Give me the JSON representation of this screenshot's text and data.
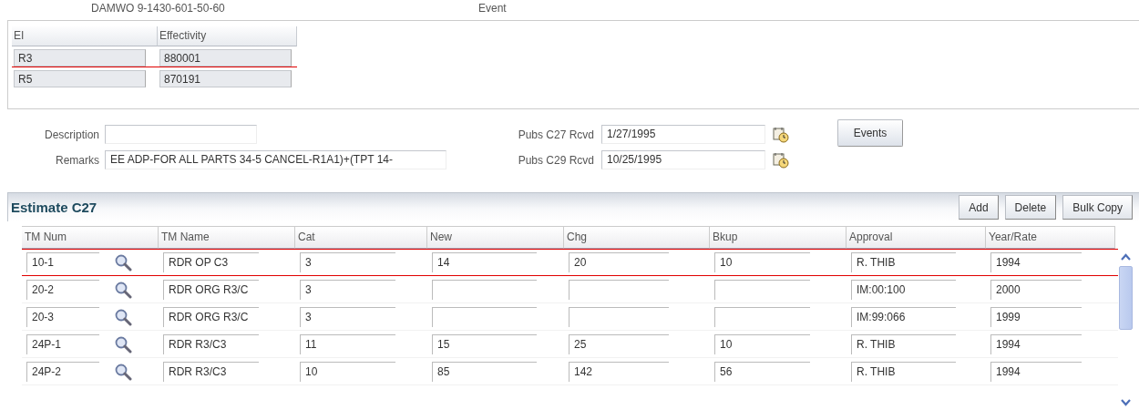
{
  "header": {
    "work_order": "DAMWO  9-1430-601-50-60",
    "event_label": "Event"
  },
  "effectivity_table": {
    "columns": [
      "EI",
      "Effectivity"
    ],
    "rows": [
      {
        "cells": [
          "R3",
          "880001"
        ],
        "selected": true
      },
      {
        "cells": [
          "R5",
          "870191"
        ],
        "selected": false
      }
    ]
  },
  "form": {
    "description": {
      "label": "Description"
    },
    "remarks": {
      "label": "Remarks",
      "value": "EE ADP-FOR ALL PARTS  34-5 CANCEL-R1A1)+(TPT 14-"
    },
    "pubs": [
      {
        "label": "Pubs C27 Rcvd",
        "value": "1/27/1995"
      },
      {
        "label": "Pubs C29 Rcvd",
        "value": "10/25/1995"
      }
    ],
    "events_button": "Events"
  },
  "estimate": {
    "title": "Estimate C27",
    "buttons": [
      "Add",
      "Delete",
      "Bulk Copy"
    ],
    "columns": [
      "TM Num",
      "TM Name",
      "Cat",
      "New",
      "Chg",
      "Bkup",
      "Approval",
      "Year/Rate"
    ],
    "rows": [
      {
        "selected": true,
        "cells": [
          "10-1",
          "RDR OP C3",
          "3",
          "14",
          "20",
          "10",
          "R. THIB",
          "1994"
        ]
      },
      {
        "selected": false,
        "cells": [
          "20-2",
          "RDR ORG R3/C",
          "3",
          null,
          null,
          null,
          "IM:00:100",
          "2000"
        ]
      },
      {
        "selected": false,
        "cells": [
          "20-3",
          "RDR ORG R3/C",
          "3",
          null,
          null,
          null,
          "IM:99:066",
          "1999"
        ]
      },
      {
        "selected": false,
        "cells": [
          "24P-1",
          "RDR R3/C3",
          "11",
          "15",
          "25",
          "10",
          "R. THIB",
          "1994"
        ]
      },
      {
        "selected": false,
        "cells": [
          "24P-2",
          "RDR R3/C3",
          "10",
          "85",
          "142",
          "56",
          "R. THIB",
          "1994"
        ]
      }
    ]
  }
}
